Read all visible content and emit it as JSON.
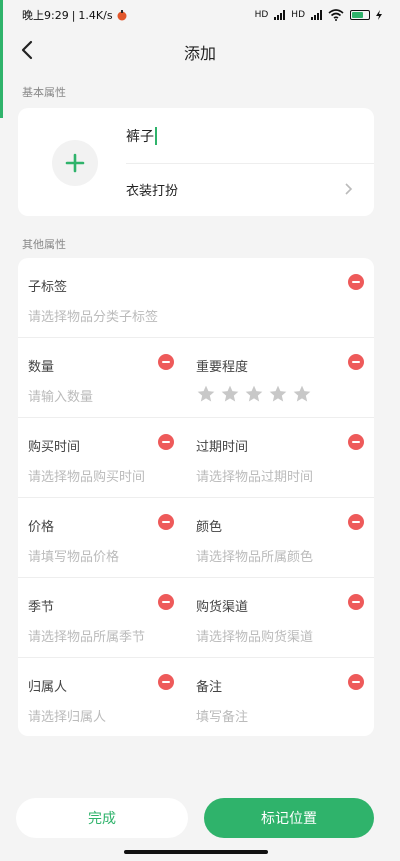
{
  "status": {
    "time": "晚上9:29",
    "speed": "1.4K/s",
    "net1": "HD",
    "net2": "HD",
    "battery": "66"
  },
  "header": {
    "title": "添加"
  },
  "basic": {
    "section_title": "基本属性",
    "name_value": "裤子",
    "category": "衣装打扮"
  },
  "other": {
    "section_title": "其他属性",
    "subtag": {
      "label": "子标签",
      "placeholder": "请选择物品分类子标签"
    },
    "quantity": {
      "label": "数量",
      "placeholder": "请输入数量"
    },
    "importance": {
      "label": "重要程度",
      "stars_total": 5,
      "stars_filled": 0
    },
    "purchase_time": {
      "label": "购买时间",
      "placeholder": "请选择物品购买时间"
    },
    "expire_time": {
      "label": "过期时间",
      "placeholder": "请选择物品过期时间"
    },
    "price": {
      "label": "价格",
      "placeholder": "请填写物品价格"
    },
    "color": {
      "label": "颜色",
      "placeholder": "请选择物品所属颜色"
    },
    "season": {
      "label": "季节",
      "placeholder": "请选择物品所属季节"
    },
    "channel": {
      "label": "购货渠道",
      "placeholder": "请选择物品购货渠道"
    },
    "owner": {
      "label": "归属人",
      "placeholder": "请选择归属人"
    },
    "note": {
      "label": "备注",
      "placeholder": "填写备注"
    }
  },
  "buttons": {
    "done": "完成",
    "mark_location": "标记位置"
  },
  "colors": {
    "accent": "#2fb36b",
    "danger": "#ee5a5a",
    "star": "#c8c8c8"
  }
}
